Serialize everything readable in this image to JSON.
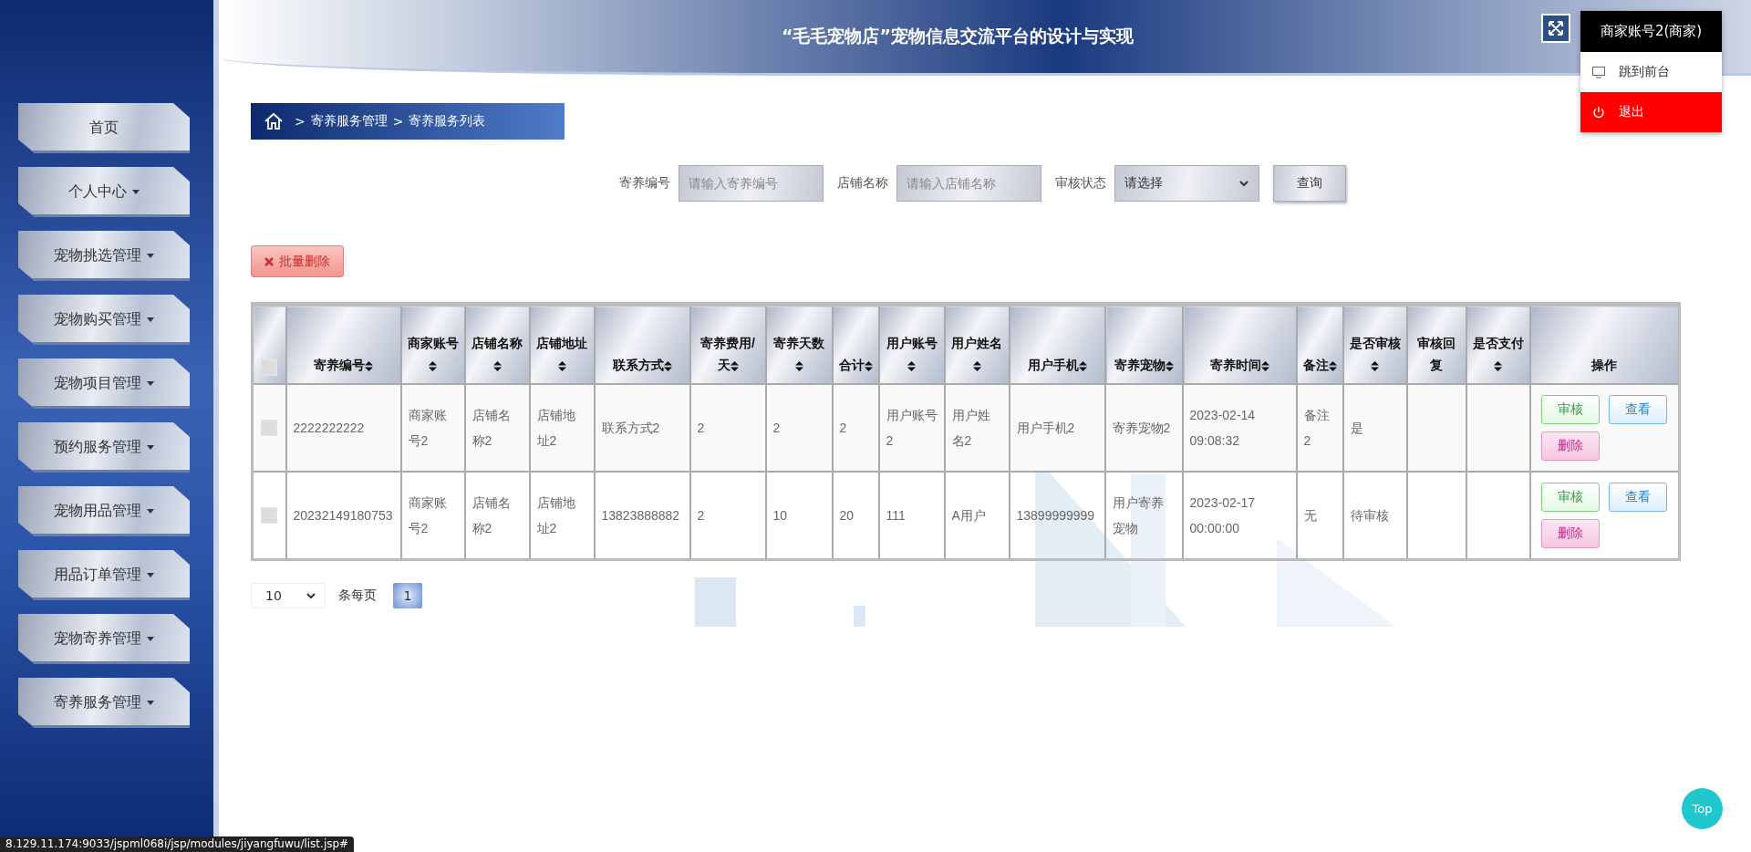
{
  "sidebar": {
    "items": [
      {
        "label": "首页",
        "has_menu": false
      },
      {
        "label": "个人中心",
        "has_menu": true
      },
      {
        "label": "宠物挑选管理",
        "has_menu": true
      },
      {
        "label": "宠物购买管理",
        "has_menu": true
      },
      {
        "label": "宠物项目管理",
        "has_menu": true
      },
      {
        "label": "预约服务管理",
        "has_menu": true
      },
      {
        "label": "宠物用品管理",
        "has_menu": true
      },
      {
        "label": "用品订单管理",
        "has_menu": true
      },
      {
        "label": "宠物寄养管理",
        "has_menu": true
      },
      {
        "label": "寄养服务管理",
        "has_menu": true
      }
    ]
  },
  "header": {
    "title": "“毛毛宠物店”宠物信息交流平台的设计与实现"
  },
  "user_menu": {
    "account": "商家账号2(商家)",
    "items": [
      {
        "label": "跳到前台",
        "kind": "frontend",
        "selected": false
      },
      {
        "label": "退出",
        "kind": "logout",
        "selected": true
      }
    ]
  },
  "breadcrumb": [
    ">",
    "寄养服务管理",
    ">",
    "寄养服务列表"
  ],
  "search": {
    "fields": [
      {
        "kind": "input",
        "label": "寄养编号",
        "placeholder": "请输入寄养编号"
      },
      {
        "kind": "input",
        "label": "店铺名称",
        "placeholder": "请输入店铺名称"
      },
      {
        "kind": "select",
        "label": "审核状态",
        "value": "请选择"
      }
    ],
    "button": "查询"
  },
  "batch_delete": "批量删除",
  "table": {
    "all_checked": false,
    "columns": [
      {
        "label": "寄养编号",
        "sortable": true
      },
      {
        "label": "商家账号",
        "sortable": true
      },
      {
        "label": "店铺名称",
        "sortable": true
      },
      {
        "label": "店铺地址",
        "sortable": true
      },
      {
        "label": "联系方式",
        "sortable": true
      },
      {
        "label": "寄养费用/天",
        "sortable": true
      },
      {
        "label": "寄养天数",
        "sortable": true
      },
      {
        "label": "合计",
        "sortable": true
      },
      {
        "label": "用户账号",
        "sortable": true
      },
      {
        "label": "用户姓名",
        "sortable": true
      },
      {
        "label": "用户手机",
        "sortable": true
      },
      {
        "label": "寄养宠物",
        "sortable": true
      },
      {
        "label": "寄养时间",
        "sortable": true
      },
      {
        "label": "备注",
        "sortable": true
      },
      {
        "label": "是否审核",
        "sortable": true
      },
      {
        "label": "审核回复",
        "sortable": false
      },
      {
        "label": "是否支付",
        "sortable": true
      },
      {
        "label": "操作",
        "sortable": false
      }
    ],
    "rows": [
      {
        "checked": false,
        "cells": [
          "2222222222",
          "商家账号2",
          "店铺名称2",
          "店铺地址2",
          "联系方式2",
          "2",
          "2",
          "2",
          "用户账号2",
          "用户姓名2",
          "用户手机2",
          "寄养宠物2",
          "2023-02-14 09:08:32",
          "备注2",
          "是",
          "",
          ""
        ],
        "actions": [
          {
            "label": "审核",
            "kind": "audit"
          },
          {
            "label": "查看",
            "kind": "view"
          },
          {
            "label": "删除",
            "kind": "delete"
          }
        ]
      },
      {
        "checked": false,
        "cells": [
          "20232149180753",
          "商家账号2",
          "店铺名称2",
          "店铺地址2",
          "13823888882",
          "2",
          "10",
          "20",
          "111",
          "A用户",
          "13899999999",
          "用户寄养宠物",
          "2023-02-17 00:00:00",
          "无",
          "待审核",
          "",
          ""
        ],
        "actions": [
          {
            "label": "审核",
            "kind": "audit"
          },
          {
            "label": "查看",
            "kind": "view"
          },
          {
            "label": "删除",
            "kind": "delete"
          }
        ]
      }
    ]
  },
  "pagination": {
    "page_size": "10",
    "label": "条每页",
    "pages": [
      {
        "label": "1",
        "selected": true
      }
    ]
  },
  "top_button": "Top",
  "status_bar": "8.129.11.174:9033/jspml068i/jsp/modules/jiyangfuwu/list.jsp#"
}
